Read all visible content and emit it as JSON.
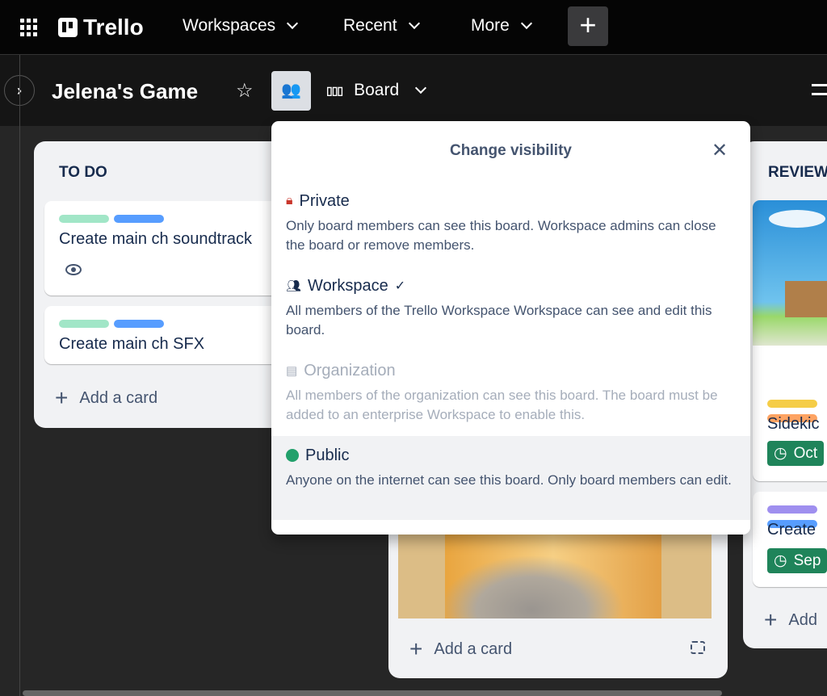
{
  "nav": {
    "logo": "Trello",
    "items": [
      "Workspaces",
      "Recent",
      "More"
    ],
    "create_label": "+"
  },
  "board": {
    "title": "Jelena's Game",
    "view": "Board"
  },
  "lists": {
    "todo": {
      "title": "TO DO",
      "cards": [
        {
          "title": "Create main ch soundtrack",
          "labels": [
            "#a1e6c7",
            "#579dff"
          ]
        },
        {
          "title": "Create main ch SFX",
          "labels": [
            "#a1e6c7",
            "#579dff"
          ]
        }
      ],
      "add": "Add a card"
    },
    "middle": {
      "add": "Add a card"
    },
    "review": {
      "title": "REVIEW",
      "cards": [
        {
          "title": "Sidekic",
          "due": "Oct",
          "labels": [
            "#f5cd47",
            "#fea362"
          ]
        },
        {
          "title": "Create",
          "due": "Sep",
          "labels": [
            "#9f8fef",
            "#579dff"
          ]
        }
      ],
      "add": "Add"
    }
  },
  "popup": {
    "title": "Change visibility",
    "options": [
      {
        "name": "Private",
        "desc": "Only board members can see this board. Workspace admins can close the board or remove members.",
        "icon": "lock-icon",
        "color": "#c9372c"
      },
      {
        "name": "Workspace",
        "desc": "All members of the Trello Workspace Workspace can see and edit this board.",
        "icon": "people-icon",
        "selected": true
      },
      {
        "name": "Organization",
        "desc": "All members of the organization can see this board. The board must be added to an enterprise Workspace to enable this.",
        "icon": "org-icon",
        "disabled": true
      },
      {
        "name": "Public",
        "desc": "Anyone on the internet can see this board. Only board members can edit.",
        "icon": "globe-icon",
        "color": "#22a06b",
        "hovered": true
      }
    ]
  }
}
